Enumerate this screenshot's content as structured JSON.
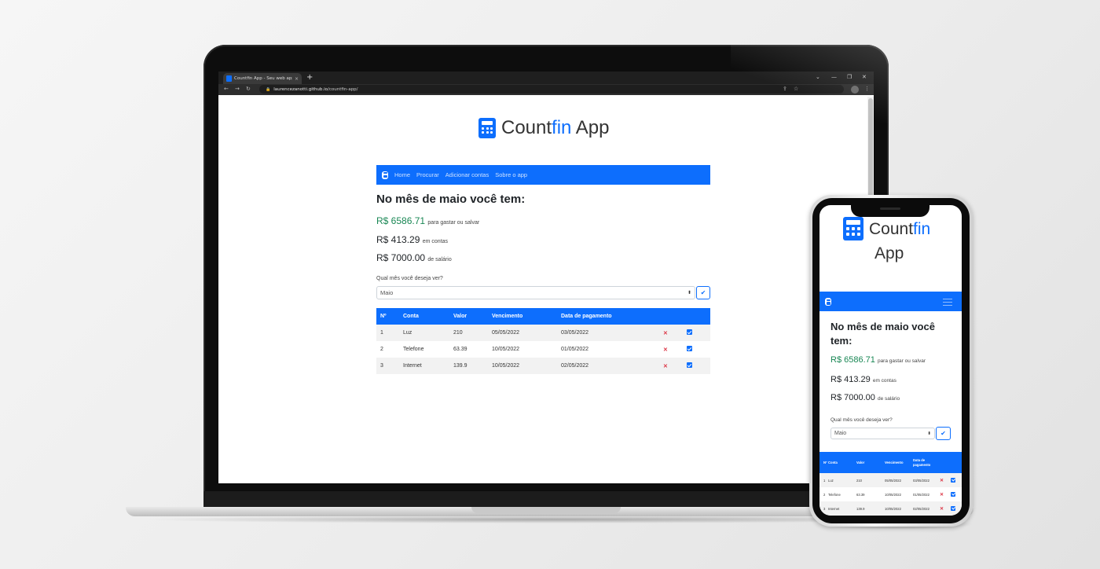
{
  "browser": {
    "tab_title": "Countfin App - Seu web app de c",
    "tab_close": "×",
    "new_tab": "+",
    "url_host": "laurencezanotti.github.io",
    "url_path": "/countfin-app/",
    "back": "←",
    "forward": "→",
    "reload": "↻",
    "minimize": "⌄",
    "min2": "—",
    "restore": "❐",
    "close": "✕",
    "share": "⇪",
    "star": "☆",
    "menu": "⋮",
    "lock": "🔒"
  },
  "app": {
    "brand_prefix": "Count",
    "brand_accent": "fin",
    "brand_suffix": " App",
    "nav": [
      "Home",
      "Procurar",
      "Adicionar contas",
      "Sobre o app"
    ],
    "heading": "No mês de maio você tem:",
    "summary": [
      {
        "amount": "R$ 6586.71",
        "label": "para gastar ou salvar",
        "accent": "green"
      },
      {
        "amount": "R$ 413.29",
        "label": "em contas",
        "accent": "default"
      },
      {
        "amount": "R$ 7000.00",
        "label": "de salário",
        "accent": "default"
      }
    ],
    "month_question": "Qual mês você deseja ver?",
    "month_selected": "Maio",
    "select_arrow": "⬍",
    "confirm_icon": "✔",
    "table": {
      "headers": [
        "Nº",
        "Conta",
        "Valor",
        "Vencimento",
        "Data de pagamento"
      ],
      "rows": [
        {
          "n": "1",
          "conta": "Luz",
          "valor": "210",
          "vencimento": "05/05/2022",
          "pagamento": "03/05/2022"
        },
        {
          "n": "2",
          "conta": "Telefone",
          "valor": "63.39",
          "vencimento": "10/05/2022",
          "pagamento": "01/05/2022"
        },
        {
          "n": "3",
          "conta": "Internet",
          "valor": "139.9",
          "vencimento": "10/05/2022",
          "pagamento": "02/05/2022"
        }
      ],
      "delete_icon": "✕"
    },
    "mobile": {
      "brand_line1": "Countfin",
      "brand_line2": "App",
      "heading_line1": "No mês de maio você",
      "heading_line2": "tem:",
      "header_pagamento_line1": "Data de",
      "header_pagamento_line2": "pagamento"
    }
  },
  "colors": {
    "primary": "#0d6efd",
    "green": "#198754",
    "danger": "#dc3545"
  },
  "icons": [
    "calculator-icon",
    "chevron-updown-icon",
    "check-icon",
    "delete-icon",
    "checkbox-icon",
    "hamburger-icon"
  ]
}
